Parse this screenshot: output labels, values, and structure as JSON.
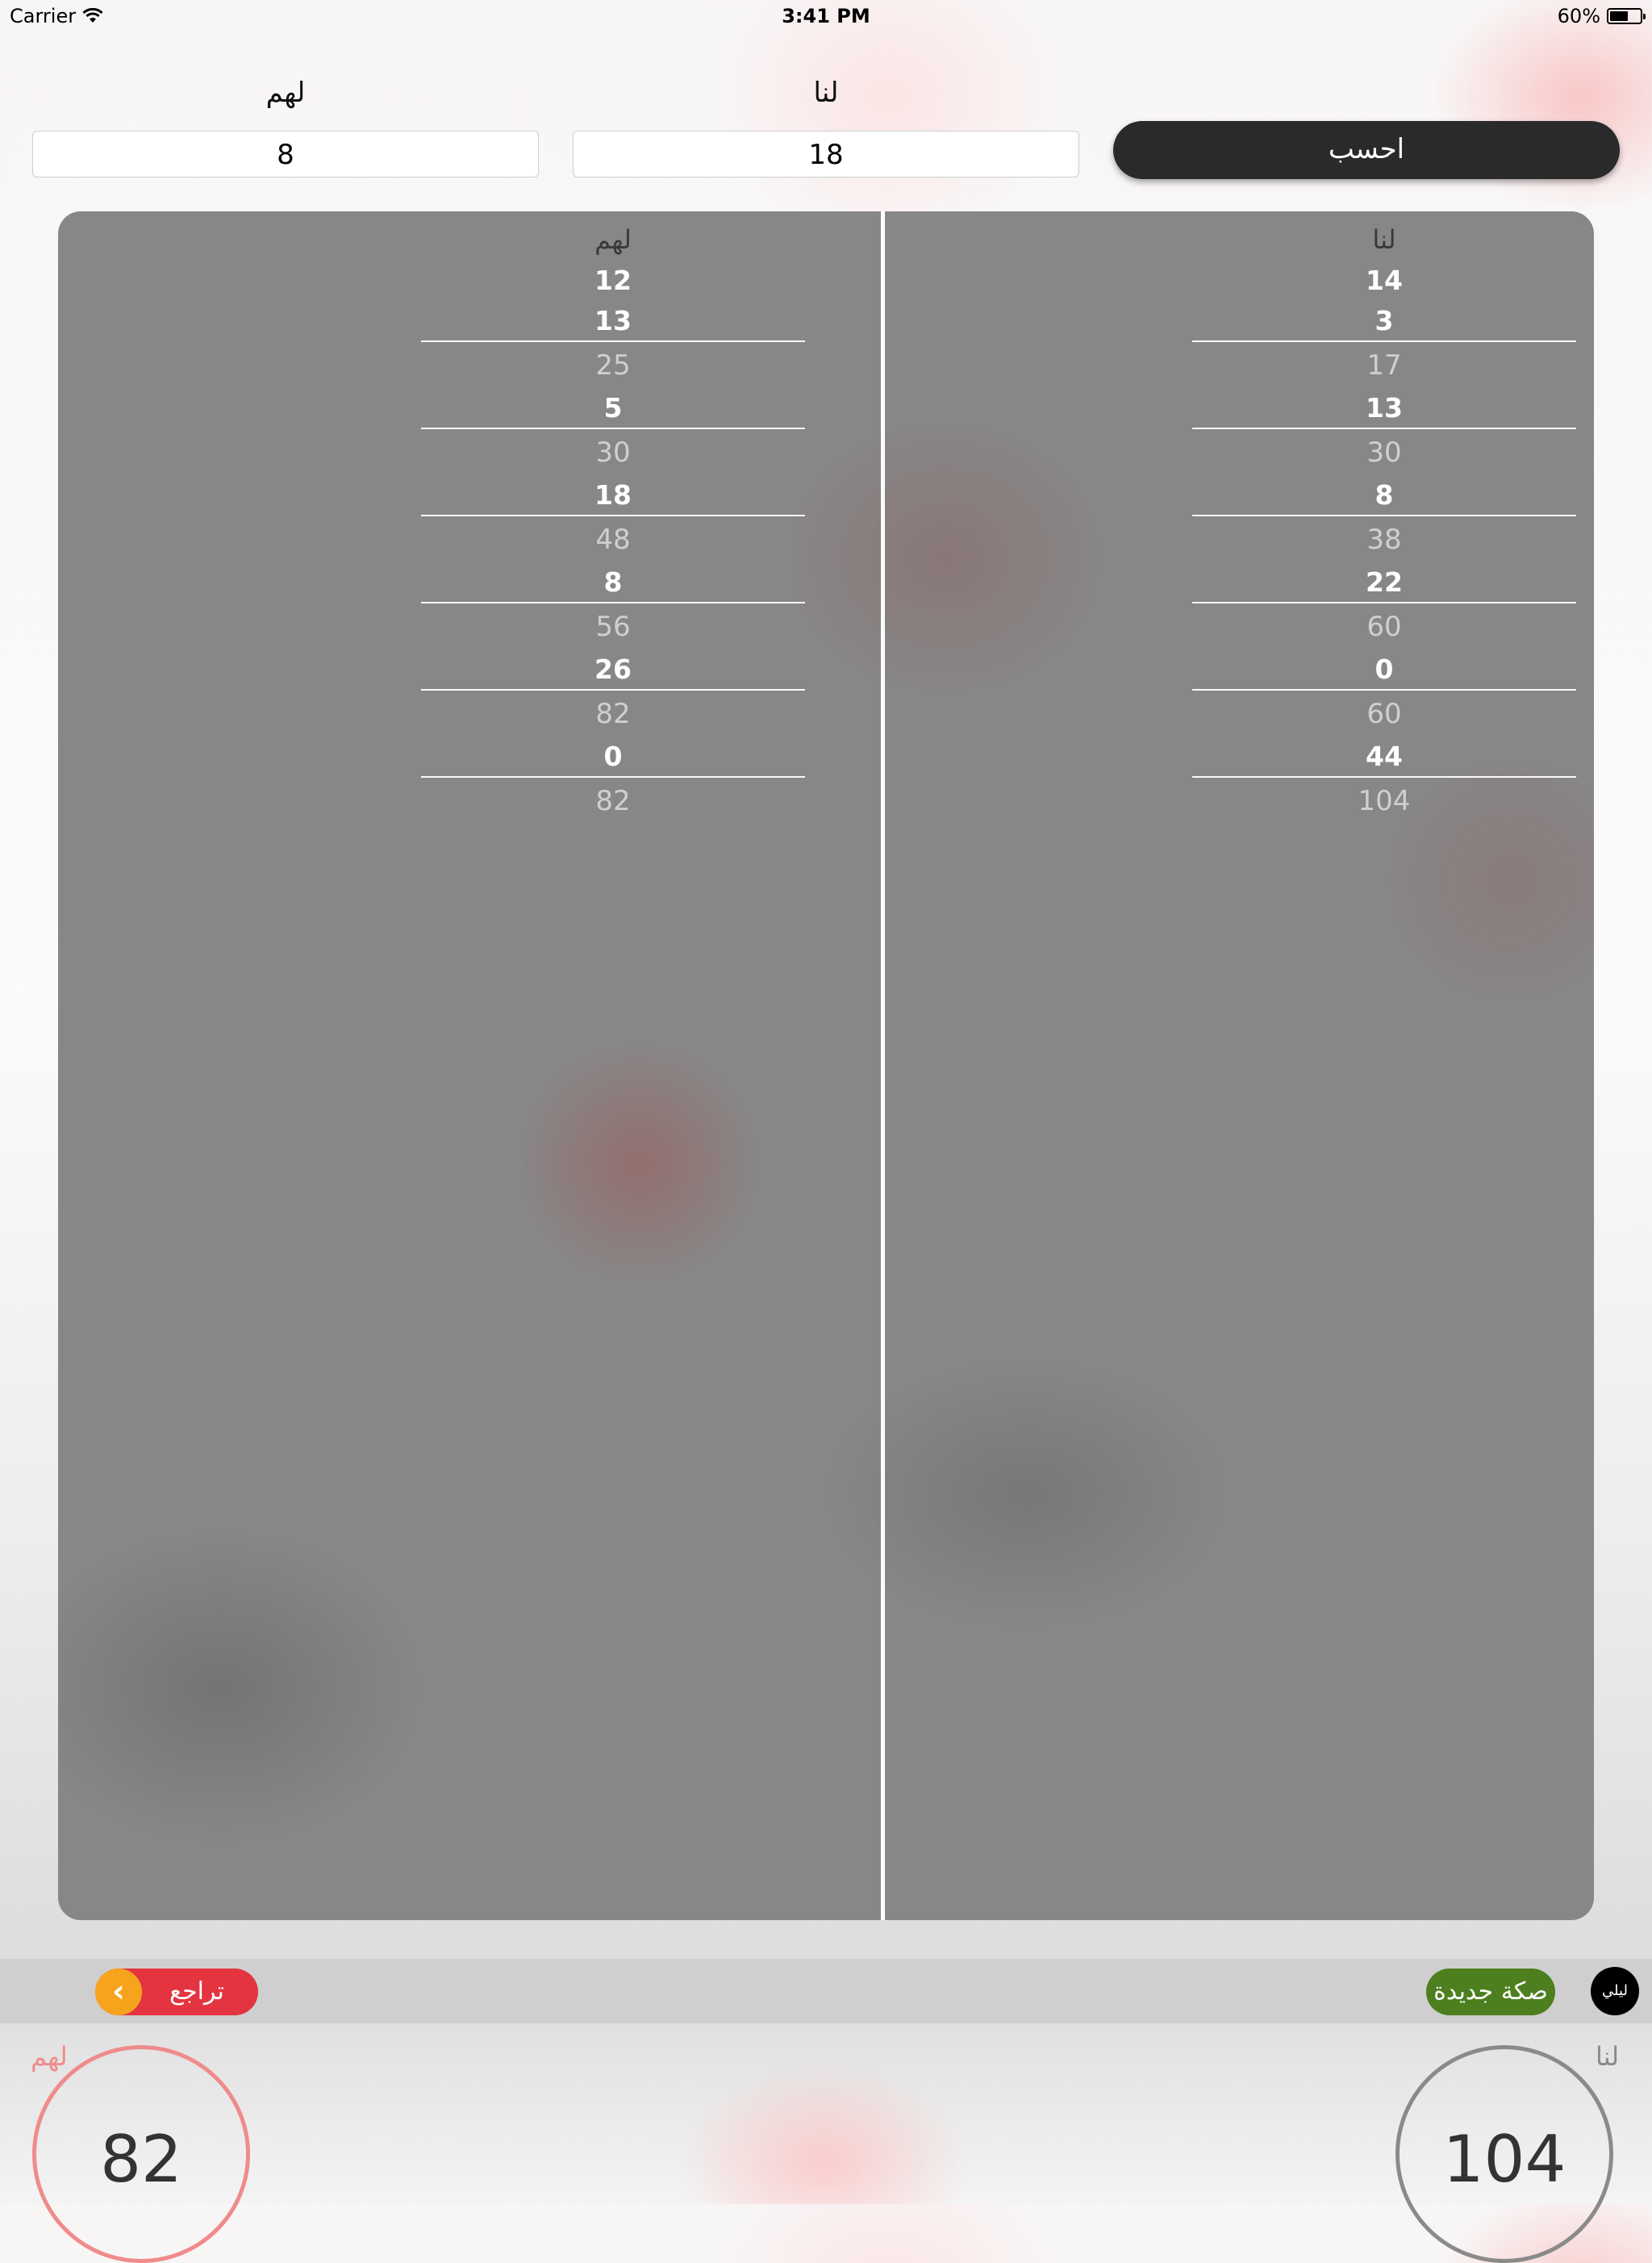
{
  "status_bar": {
    "carrier": "Carrier",
    "time": "3:41 PM",
    "battery": "60%",
    "battery_level": 0.6
  },
  "inputs": {
    "them_label": "لهم",
    "them_value": "8",
    "us_label": "لنا",
    "us_value": "18",
    "calculate_label": "احسب"
  },
  "scoresheet": {
    "them": {
      "header": "لهم",
      "rounds": [
        {
          "entries": [
            "12",
            "13"
          ],
          "total": "25"
        },
        {
          "entries": [
            "5"
          ],
          "total": "30"
        },
        {
          "entries": [
            "18"
          ],
          "total": "48"
        },
        {
          "entries": [
            "8"
          ],
          "total": "56"
        },
        {
          "entries": [
            "26"
          ],
          "total": "82"
        },
        {
          "entries": [
            "0"
          ],
          "total": "82"
        }
      ]
    },
    "us": {
      "header": "لنا",
      "rounds": [
        {
          "entries": [
            "14",
            "3"
          ],
          "total": "17"
        },
        {
          "entries": [
            "13"
          ],
          "total": "30"
        },
        {
          "entries": [
            "8"
          ],
          "total": "38"
        },
        {
          "entries": [
            "22"
          ],
          "total": "60"
        },
        {
          "entries": [
            "0"
          ],
          "total": "60"
        },
        {
          "entries": [
            "44"
          ],
          "total": "104"
        }
      ]
    }
  },
  "toolbar": {
    "undo_label": "تراجع",
    "undo_icon": "chevron-left-icon",
    "new_game_label": "صكة جديدة",
    "night_mode_label": "ليلي"
  },
  "totals": {
    "them_label": "لهم",
    "them_total": "82",
    "us_label": "لنا",
    "us_total": "104"
  },
  "colors": {
    "them_accent": "#f08b8b",
    "us_accent": "#8a8a8a",
    "undo": "#e3343f",
    "undo_arrow": "#f7a41c",
    "new_game": "#4d7f1e"
  }
}
